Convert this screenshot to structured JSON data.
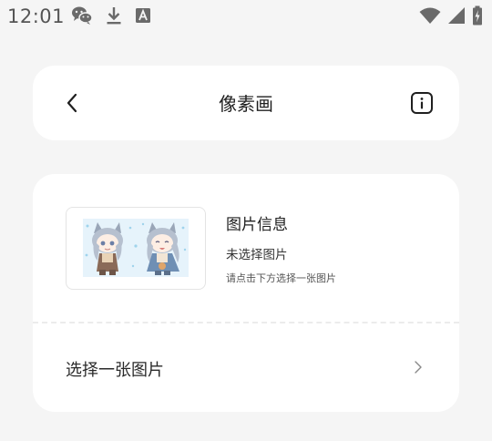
{
  "status_bar": {
    "time": "12:01",
    "left_icons": [
      "wechat-icon",
      "download-icon",
      "font-a-icon"
    ],
    "right_icons": [
      "wifi-icon",
      "cellular-signal-icon",
      "battery-charging-icon"
    ]
  },
  "header": {
    "back_icon": "back-chevron-icon",
    "title": "像素画",
    "info_icon": "info-icon"
  },
  "image_info": {
    "thumbnail": "anime-character-preview",
    "title": "图片信息",
    "status": "未选择图片",
    "hint": "请点击下方选择一张图片"
  },
  "select_row": {
    "label": "选择一张图片",
    "icon": "chevron-right-icon"
  },
  "colors": {
    "background": "#f5f5f5",
    "card": "#ffffff",
    "text_primary": "#1f1f1f",
    "text_secondary": "#555555",
    "divider": "#ececec"
  }
}
